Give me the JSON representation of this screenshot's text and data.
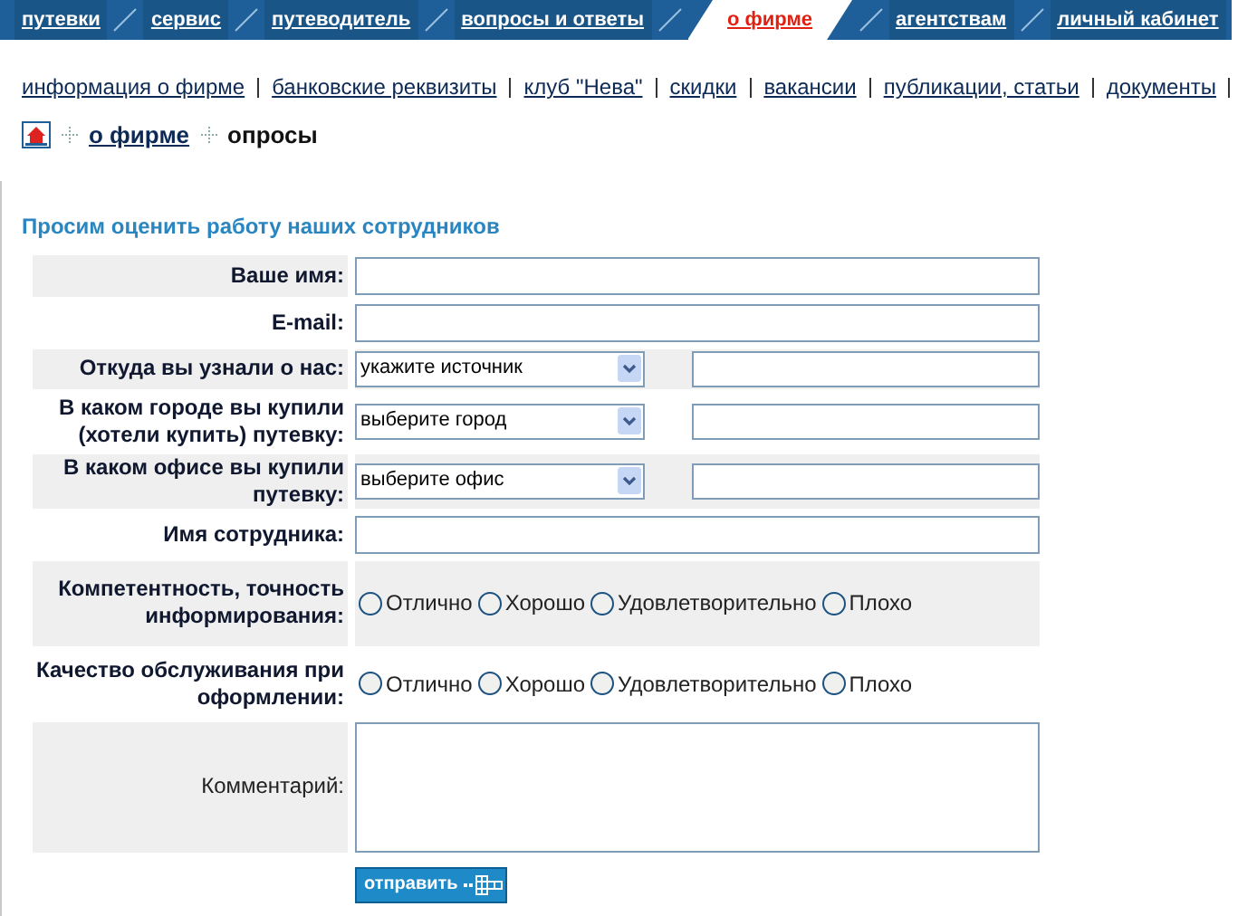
{
  "nav_tabs": [
    {
      "label": "путевки",
      "selected": false
    },
    {
      "label": "сервис",
      "selected": false
    },
    {
      "label": "путеводитель",
      "selected": false
    },
    {
      "label": "вопросы и ответы",
      "selected": false
    },
    {
      "label": "о фирме",
      "selected": true
    },
    {
      "label": "агентствам",
      "selected": false
    },
    {
      "label": "личный кабинет",
      "selected": false
    }
  ],
  "sub_links": [
    "информация о фирме",
    "банковские реквизиты",
    "клуб \"Нева\"",
    "скидки",
    "вакансии",
    "публикации, статьи",
    "документы"
  ],
  "breadcrumb": {
    "link": "о фирме",
    "current": "опросы"
  },
  "form": {
    "title": "Просим оценить работу наших сотрудников",
    "rows": [
      {
        "kind": "text",
        "label": "Ваше имя:"
      },
      {
        "kind": "text",
        "label": "E-mail:"
      },
      {
        "kind": "select",
        "label": "Откуда вы узнали о нас:",
        "value": "укажите источник"
      },
      {
        "kind": "select",
        "label": "В каком городе вы купили (хотели купить) путевку:",
        "value": "выберите город"
      },
      {
        "kind": "select",
        "label": "В каком офисе вы купили путевку:",
        "value": "выберите офис"
      },
      {
        "kind": "text",
        "label": "Имя сотрудника:"
      },
      {
        "kind": "radio",
        "label": "Компетентность, точность информирования:",
        "options": [
          {
            "label": "Отлично",
            "selected": false
          },
          {
            "label": "Хорошо",
            "selected": false
          },
          {
            "label": "Удовлетворительно",
            "selected": false
          },
          {
            "label": "Плохо",
            "selected": false
          }
        ]
      },
      {
        "kind": "radio",
        "label": "Качество обслуживания при оформлении:",
        "options": [
          {
            "label": "Отлично",
            "selected": false
          },
          {
            "label": "Хорошо",
            "selected": false
          },
          {
            "label": "Удовлетворительно",
            "selected": false
          },
          {
            "label": "Плохо",
            "selected": false
          }
        ]
      },
      {
        "kind": "textarea",
        "label": "Комментарий:"
      }
    ],
    "submit": "отправить"
  }
}
